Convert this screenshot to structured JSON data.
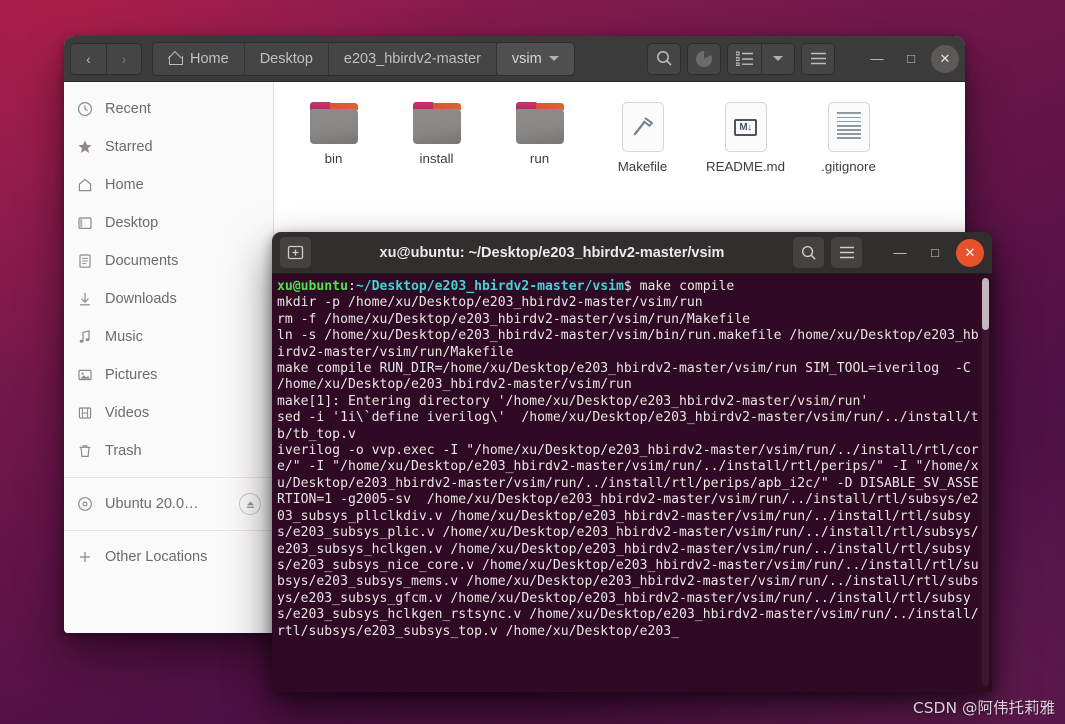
{
  "file_manager": {
    "nav": {
      "back": "‹",
      "forward": "›"
    },
    "breadcrumbs": [
      {
        "label": "Home",
        "icon": "home-icon",
        "active": false
      },
      {
        "label": "Desktop",
        "icon": "",
        "active": false
      },
      {
        "label": "e203_hbirdv2-master",
        "icon": "",
        "active": false
      },
      {
        "label": "vsim",
        "icon": "chevron-down-icon",
        "active": true
      }
    ],
    "toolbar": [
      {
        "name": "search-icon",
        "glyph": "⚲"
      },
      {
        "name": "pie-progress-icon",
        "glyph": ""
      },
      {
        "name": "list-view-icon",
        "glyph": ""
      },
      {
        "name": "view-options-chevron-icon",
        "glyph": ""
      },
      {
        "name": "hamburger-menu-icon",
        "glyph": "☰"
      }
    ],
    "window_controls": {
      "minimize": "—",
      "maximize": "□",
      "close": "✕"
    },
    "sidebar": {
      "items": [
        {
          "label": "Recent",
          "icon": "clock-icon"
        },
        {
          "label": "Starred",
          "icon": "star-icon"
        },
        {
          "label": "Home",
          "icon": "home-icon"
        },
        {
          "label": "Desktop",
          "icon": "desktop-icon"
        },
        {
          "label": "Documents",
          "icon": "document-icon"
        },
        {
          "label": "Downloads",
          "icon": "download-icon"
        },
        {
          "label": "Music",
          "icon": "music-note-icon"
        },
        {
          "label": "Pictures",
          "icon": "picture-icon"
        },
        {
          "label": "Videos",
          "icon": "video-icon"
        },
        {
          "label": "Trash",
          "icon": "trash-icon"
        }
      ],
      "device": {
        "label": "Ubuntu 20.0…",
        "icon": "disc-icon",
        "eject": "eject-icon"
      },
      "other_locations": {
        "label": "Other Locations",
        "icon": "plus-icon"
      }
    },
    "files": [
      {
        "name": "bin",
        "type": "folder"
      },
      {
        "name": "install",
        "type": "folder"
      },
      {
        "name": "run",
        "type": "folder"
      },
      {
        "name": "Makefile",
        "type": "makefile"
      },
      {
        "name": "README.md",
        "type": "markdown"
      },
      {
        "name": ".gitignore",
        "type": "text"
      }
    ]
  },
  "terminal": {
    "title": "xu@ubuntu: ~/Desktop/e203_hbirdv2-master/vsim",
    "header_buttons": [
      {
        "name": "new-tab-icon"
      },
      {
        "name": "search-icon"
      },
      {
        "name": "hamburger-menu-icon"
      }
    ],
    "window_controls": {
      "minimize": "—",
      "maximize": "□",
      "close": "✕"
    },
    "prompt": {
      "user": "xu@ubuntu",
      "colon": ":",
      "path": "~/Desktop/e203_hbirdv2-master/vsim",
      "sigil": "$ ",
      "command": "make compile"
    },
    "output": "mkdir -p /home/xu/Desktop/e203_hbirdv2-master/vsim/run\nrm -f /home/xu/Desktop/e203_hbirdv2-master/vsim/run/Makefile\nln -s /home/xu/Desktop/e203_hbirdv2-master/vsim/bin/run.makefile /home/xu/Desktop/e203_hbirdv2-master/vsim/run/Makefile\nmake compile RUN_DIR=/home/xu/Desktop/e203_hbirdv2-master/vsim/run SIM_TOOL=iverilog  -C /home/xu/Desktop/e203_hbirdv2-master/vsim/run\nmake[1]: Entering directory '/home/xu/Desktop/e203_hbirdv2-master/vsim/run'\nsed -i '1i\\`define iverilog\\'  /home/xu/Desktop/e203_hbirdv2-master/vsim/run/../install/tb/tb_top.v\niverilog -o vvp.exec -I \"/home/xu/Desktop/e203_hbirdv2-master/vsim/run/../install/rtl/core/\" -I \"/home/xu/Desktop/e203_hbirdv2-master/vsim/run/../install/rtl/perips/\" -I \"/home/xu/Desktop/e203_hbirdv2-master/vsim/run/../install/rtl/perips/apb_i2c/\" -D DISABLE_SV_ASSERTION=1 -g2005-sv  /home/xu/Desktop/e203_hbirdv2-master/vsim/run/../install/rtl/subsys/e203_subsys_pllclkdiv.v /home/xu/Desktop/e203_hbirdv2-master/vsim/run/../install/rtl/subsys/e203_subsys_plic.v /home/xu/Desktop/e203_hbirdv2-master/vsim/run/../install/rtl/subsys/e203_subsys_hclkgen.v /home/xu/Desktop/e203_hbirdv2-master/vsim/run/../install/rtl/subsys/e203_subsys_nice_core.v /home/xu/Desktop/e203_hbirdv2-master/vsim/run/../install/rtl/subsys/e203_subsys_mems.v /home/xu/Desktop/e203_hbirdv2-master/vsim/run/../install/rtl/subsys/e203_subsys_gfcm.v /home/xu/Desktop/e203_hbirdv2-master/vsim/run/../install/rtl/subsys/e203_subsys_hclkgen_rstsync.v /home/xu/Desktop/e203_hbirdv2-master/vsim/run/../install/rtl/subsys/e203_subsys_top.v /home/xu/Desktop/e203_"
  },
  "watermark": {
    "text": "CSDN @阿伟托莉雅"
  },
  "colors": {
    "terminal_bg": "#300a24",
    "prompt_user": "#4ee24e",
    "prompt_path": "#45d3d3",
    "close_button": "#e8522a",
    "folder_tab": "#c3366d",
    "folder_strip": "#e0642f"
  }
}
